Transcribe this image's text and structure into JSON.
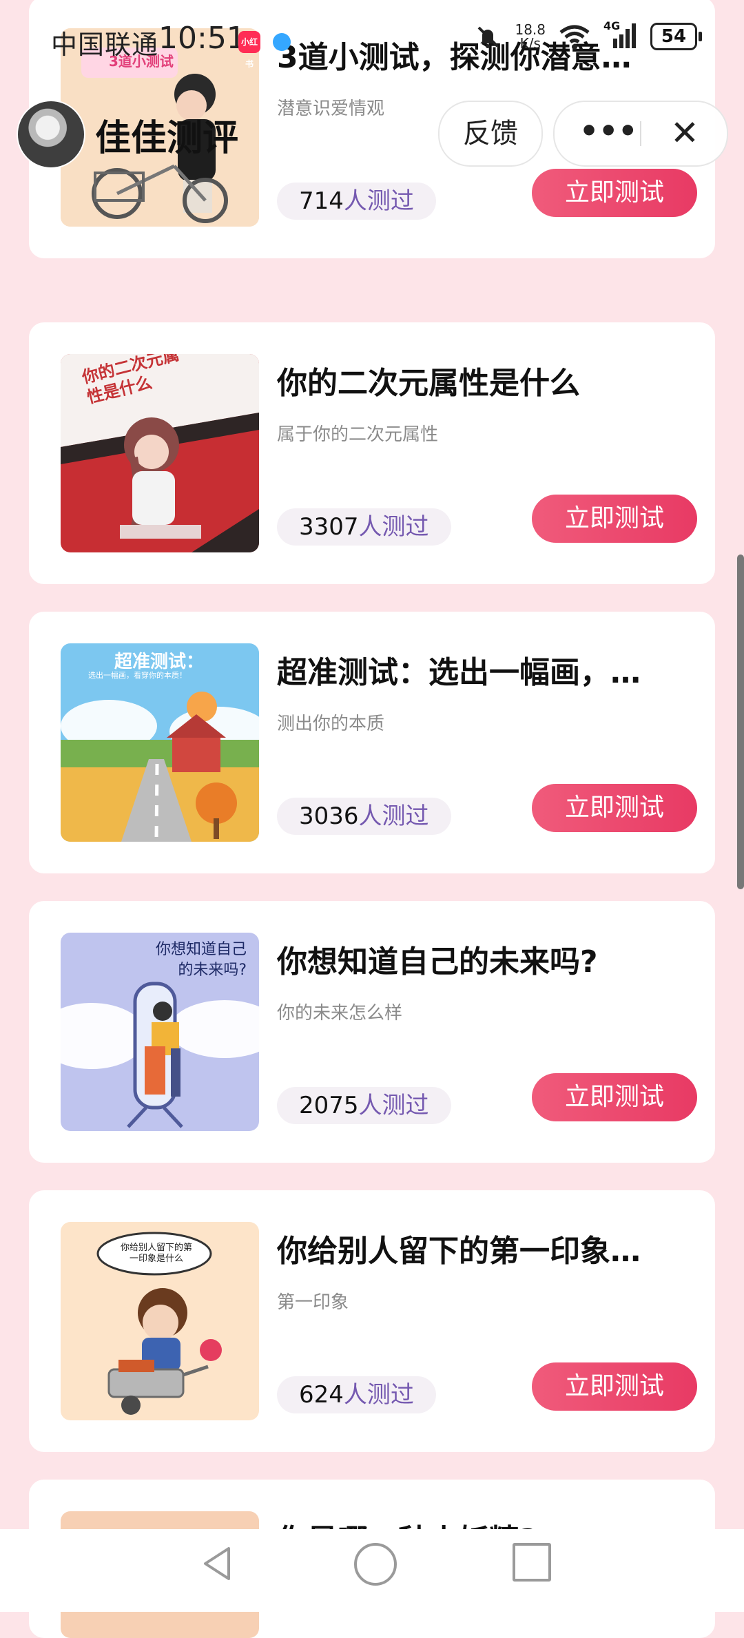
{
  "status_bar": {
    "carrier": "中国联通",
    "time": "10:51",
    "mini_badge": "小红书",
    "net_speed_value": "18.8",
    "net_speed_unit": "K/s",
    "signal_label": "4G",
    "battery": "54"
  },
  "header": {
    "app_name": "佳佳测评",
    "feedback_label": "反馈",
    "more_label": "•••",
    "close_label": "✕"
  },
  "cards": [
    {
      "title": "3道小测试，探测你潜意…",
      "subtitle": "潜意识爱情观",
      "count": "714",
      "count_suffix": "人测过",
      "button_label": "立即测试",
      "thumb_text": "3道小测试"
    },
    {
      "title": "你的二次元属性是什么",
      "subtitle": "属于你的二次元属性",
      "count": "3307",
      "count_suffix": "人测过",
      "button_label": "立即测试",
      "thumb_text": "你的二次元属性是什么"
    },
    {
      "title": "超准测试：选出一幅画，…",
      "subtitle": "测出你的本质",
      "count": "3036",
      "count_suffix": "人测过",
      "button_label": "立即测试",
      "thumb_text": "超准测试：",
      "thumb_subtext": "选出一幅画，看穿你的本质！"
    },
    {
      "title": "你想知道自己的未来吗?",
      "subtitle": "你的未来怎么样",
      "count": "2075",
      "count_suffix": "人测过",
      "button_label": "立即测试",
      "thumb_text": "你想知道自己的未来吗?"
    },
    {
      "title": "你给别人留下的第一印象…",
      "subtitle": "第一印象",
      "count": "624",
      "count_suffix": "人测过",
      "button_label": "立即测试",
      "thumb_text": "你给别人留下的第一印象是什么"
    }
  ],
  "partial_card": {
    "title": "你是哪一种小妖精?"
  },
  "colors": {
    "page_bg": "#fde4e8",
    "button": "#eb4d6f",
    "count_suffix": "#7559b0"
  },
  "icons": [
    "mute-icon",
    "wifi-icon",
    "signal-icon",
    "battery-icon",
    "close-icon",
    "more-icon",
    "back-icon",
    "home-icon",
    "recent-apps-icon"
  ]
}
